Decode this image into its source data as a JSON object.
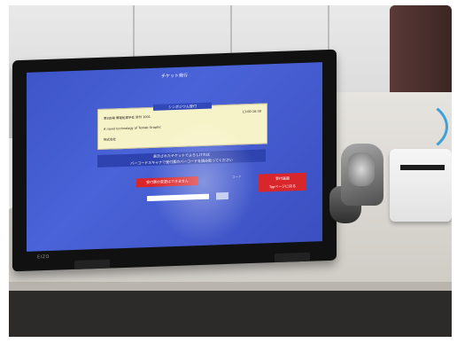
{
  "screen": {
    "title": "チケット発行",
    "ticket": {
      "band_label": "シンポジウム受付",
      "line1": "第8会場 情報処理学会 受付 1001",
      "line2": "A novel technology of Tenlab Graphic",
      "line3": "株式会社",
      "time": "13:00-16:30"
    },
    "scan_message": "表示されたチケットでよろしければ\nバーコードスキャナで受付票のバーコードを読み取ってください",
    "change_button": "受付票の変更はできません",
    "small_label": "コード",
    "top_button": "受付画面\nTopページに戻る"
  },
  "monitor": {
    "brand": "EIZO"
  },
  "colors": {
    "screen_blue": "#3d55c8",
    "button_red": "#d9262b",
    "ticket_yellow": "#f7f3c8"
  }
}
